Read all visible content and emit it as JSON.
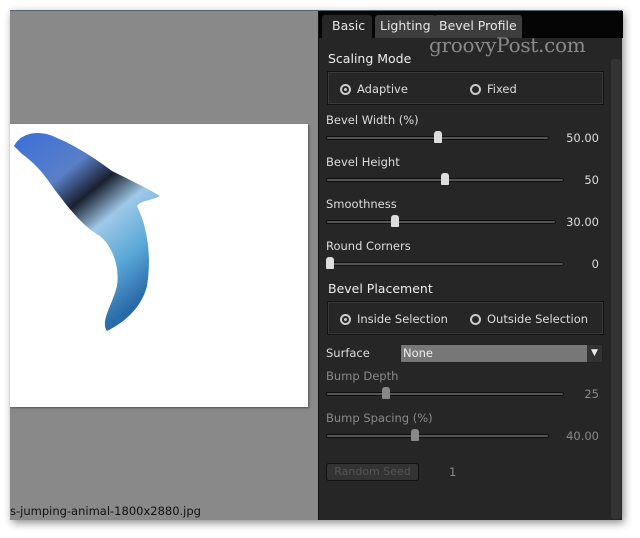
{
  "preview": {
    "filename": "s-jumping-animal-1800x2880.jpg"
  },
  "tabs": [
    {
      "label": "Basic",
      "active": true
    },
    {
      "label": "Lighting",
      "active": false
    },
    {
      "label": "Bevel Profile",
      "active": false
    }
  ],
  "watermark": "groovyPost.com",
  "scaling_mode": {
    "title": "Scaling Mode",
    "options": [
      {
        "label": "Adaptive",
        "selected": true
      },
      {
        "label": "Fixed",
        "selected": false
      }
    ]
  },
  "sliders": [
    {
      "label": "Bevel Width (%)",
      "value": "50.00",
      "fraction": 0.5
    },
    {
      "label": "Bevel Height",
      "value": "50",
      "fraction": 0.5
    },
    {
      "label": "Smoothness",
      "value": "30.00",
      "fraction": 0.3
    },
    {
      "label": "Round Corners",
      "value": "0",
      "fraction": 0.0
    }
  ],
  "bevel_placement": {
    "title": "Bevel Placement",
    "options": [
      {
        "label": "Inside Selection",
        "selected": true
      },
      {
        "label": "Outside Selection",
        "selected": false
      }
    ]
  },
  "surface": {
    "label": "Surface",
    "value": "None"
  },
  "bump_sliders": [
    {
      "label": "Bump Depth",
      "value": "25",
      "fraction": 0.25
    },
    {
      "label": "Bump Spacing (%)",
      "value": "40.00",
      "fraction": 0.4
    }
  ],
  "random_seed": {
    "label": "Random Seed",
    "value": "1"
  },
  "colors": {
    "panel": "#262626",
    "preview_bg": "#898989"
  }
}
